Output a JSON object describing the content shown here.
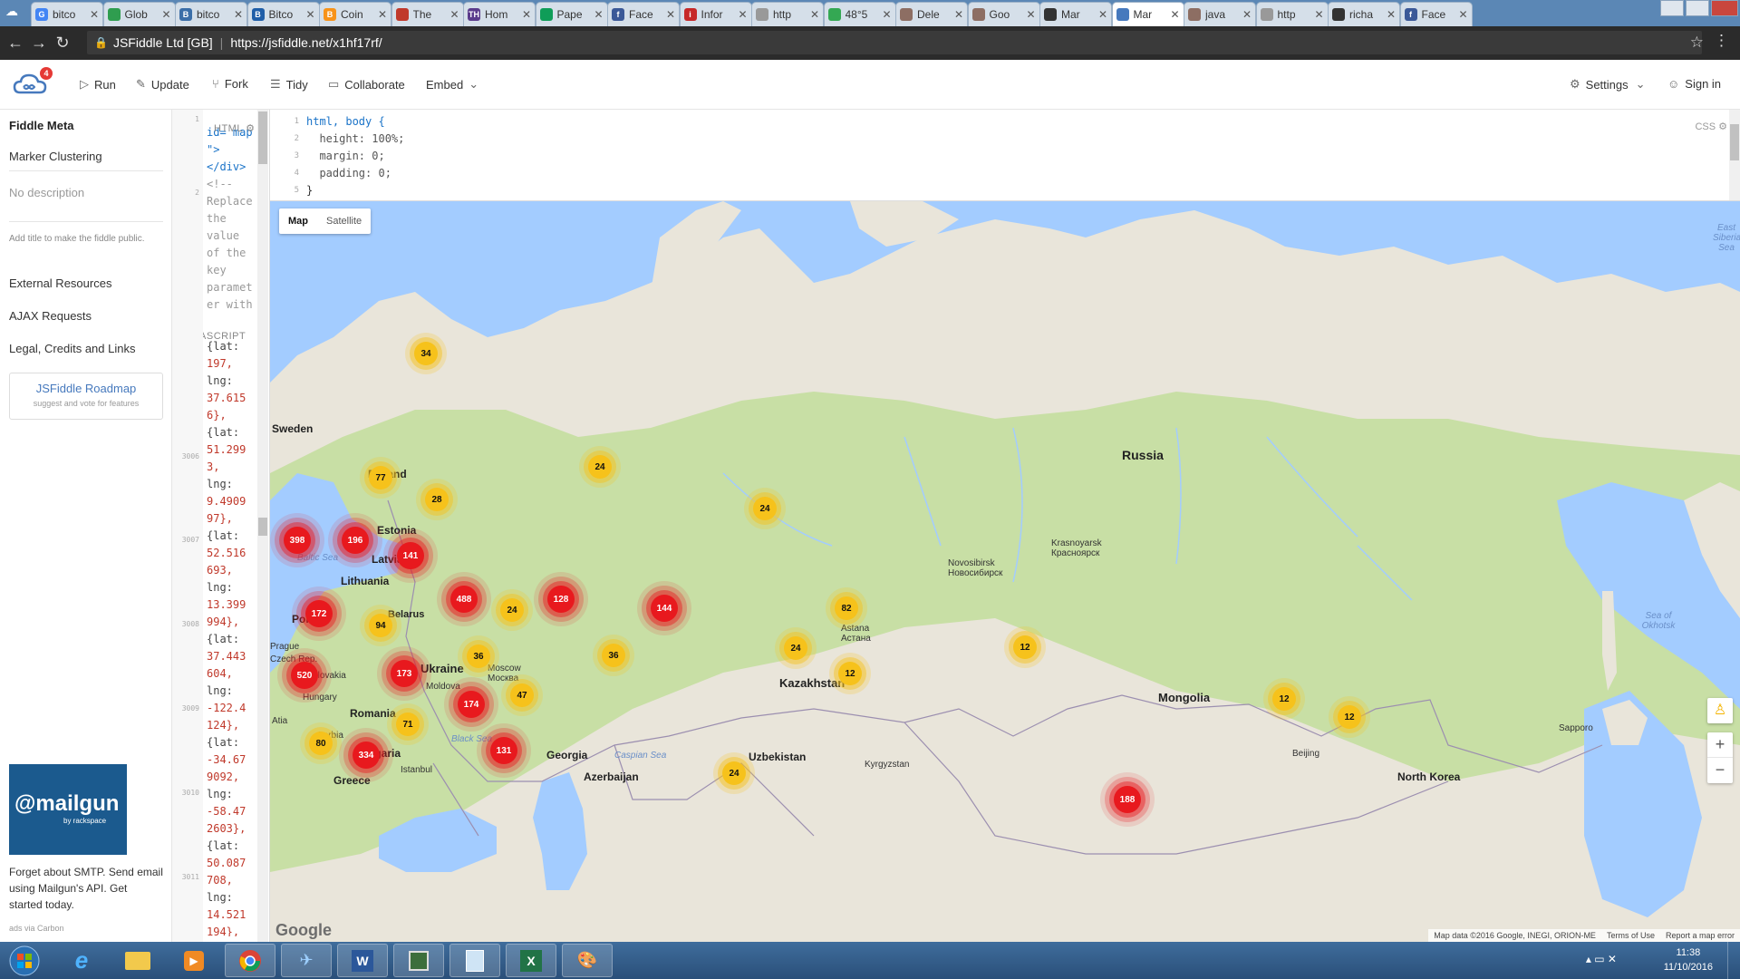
{
  "browser": {
    "tabs": [
      {
        "title": "bitco",
        "icon": "google-icon",
        "color": "#4285f4",
        "glyph": "G"
      },
      {
        "title": "Glob",
        "icon": "generic-page-icon",
        "color": "#2f9d4f",
        "glyph": ""
      },
      {
        "title": "bitco",
        "icon": "bitcointalk-icon",
        "color": "#3b6ea8",
        "glyph": "B"
      },
      {
        "title": "Bitco",
        "icon": "bitcoin-b-icon",
        "color": "#1f5ea8",
        "glyph": "B"
      },
      {
        "title": "Coin",
        "icon": "bitcoin-icon",
        "color": "#f7931a",
        "glyph": "B"
      },
      {
        "title": "The",
        "icon": "bookmark-icon",
        "color": "#c0392b",
        "glyph": ""
      },
      {
        "title": "Hom",
        "icon": "th-icon",
        "color": "#5b3c8c",
        "glyph": "TH"
      },
      {
        "title": "Pape",
        "icon": "sheets-icon",
        "color": "#0f9d58",
        "glyph": ""
      },
      {
        "title": "Face",
        "icon": "facebook-icon",
        "color": "#3b5998",
        "glyph": "f"
      },
      {
        "title": "Infor",
        "icon": "info-icon",
        "color": "#c62828",
        "glyph": "i"
      },
      {
        "title": "http",
        "icon": "blank-page-icon",
        "color": "#999999",
        "glyph": ""
      },
      {
        "title": "48°5",
        "icon": "maps-icon",
        "color": "#34a853",
        "glyph": ""
      },
      {
        "title": "Dele",
        "icon": "tools-icon",
        "color": "#8d6e63",
        "glyph": ""
      },
      {
        "title": "Goo",
        "icon": "tools-icon",
        "color": "#8d6e63",
        "glyph": ""
      },
      {
        "title": "Mar",
        "icon": "github-icon",
        "color": "#333333",
        "glyph": ""
      },
      {
        "title": "Mar",
        "icon": "jsfiddle-icon",
        "color": "#4679bd",
        "glyph": ""
      },
      {
        "title": "java",
        "icon": "tools-icon",
        "color": "#8d6e63",
        "glyph": ""
      },
      {
        "title": "http",
        "icon": "blank-page-icon",
        "color": "#999999",
        "glyph": ""
      },
      {
        "title": "richa",
        "icon": "github-icon",
        "color": "#333333",
        "glyph": ""
      },
      {
        "title": "Face",
        "icon": "facebook-icon",
        "color": "#3b5998",
        "glyph": "f"
      }
    ],
    "active_tab_index": 15,
    "site_name": "JSFiddle Ltd [GB]",
    "url": "https://jsfiddle.net/x1hf17rf/"
  },
  "toolbar": {
    "badge": "4",
    "run": "Run",
    "update": "Update",
    "fork": "Fork",
    "tidy": "Tidy",
    "collaborate": "Collaborate",
    "embed": "Embed",
    "settings": "Settings",
    "signin": "Sign in"
  },
  "meta": {
    "heading": "Fiddle Meta",
    "title_value": "Marker Clustering",
    "description_placeholder": "No description",
    "public_hint": "Add title to make the fiddle public.",
    "links": [
      "External Resources",
      "AJAX Requests",
      "Legal, Credits and Links"
    ],
    "roadmap_title": "JSFiddle Roadmap",
    "roadmap_sub": "suggest and vote for features",
    "ad_brand": "@mailgun",
    "ad_brand_sub": "by rackspace",
    "ad_text": "Forget about SMTP. Send email using Mailgun's API. Get started today.",
    "ad_credit": "ads via Carbon"
  },
  "editors": {
    "html_label": "HTML",
    "html_lines": [
      "id= map",
      "\">",
      "</div>",
      "<!--",
      "Replace",
      "the",
      "value",
      "of the",
      "key",
      "paramet",
      "er with"
    ],
    "js_label": "JAVASCRIPT",
    "js_lines": [
      "{lat:",
      "197,",
      "lng:",
      "37.615",
      "6},",
      "{lat:",
      "51.299",
      "3,",
      "lng:",
      "9.4909",
      "97},",
      "{lat:",
      "52.516",
      "693,",
      "lng:",
      "13.399",
      "994},",
      "{lat:",
      "37.443",
      "604,",
      "lng:",
      "-122.4",
      "124},",
      "{lat:",
      "-34.67",
      "9092,",
      "lng:",
      "-58.47",
      "2603},",
      "{lat:",
      "50.087",
      "708,",
      "lng:",
      "14.521",
      "194},",
      "{lat:"
    ],
    "js_line_numbers": [
      "3006",
      "3007",
      "3008",
      "3009",
      "3010",
      "3011"
    ],
    "css_label": "CSS",
    "css_lines": [
      "html, body {",
      "  height: 100%;",
      "  margin: 0;",
      "  padding: 0;",
      "}"
    ]
  },
  "map": {
    "type_buttons": [
      "Map",
      "Satellite"
    ],
    "countries": [
      "Russia",
      "Kazakhstan",
      "Mongolia",
      "Ukraine",
      "Belarus",
      "Poland",
      "Finland",
      "Sweden",
      "Estonia",
      "Latvia",
      "Lithuania",
      "Romania",
      "Bulgaria",
      "Georgia",
      "Azerbaijan",
      "Uzbekistan",
      "Kyrgyzstan",
      "Hungary",
      "Slovakia",
      "Moldova",
      "Greece",
      "North Korea",
      "Serbia",
      "Czech Rep.",
      "Atia"
    ],
    "cities": [
      {
        "name": "Moscow",
        "name2": "Москва"
      },
      {
        "name": "Novosibirsk",
        "name2": "Новосибирск"
      },
      {
        "name": "Krasnoyarsk",
        "name2": "Красноярск"
      },
      {
        "name": "Astana",
        "name2": "Астана"
      },
      {
        "name": "Istanbul",
        "name2": ""
      },
      {
        "name": "Beijing",
        "name2": ""
      },
      {
        "name": "Sapporo",
        "name2": ""
      },
      {
        "name": "Prague",
        "name2": ""
      }
    ],
    "seas": [
      "Baltic Sea",
      "Black Sea",
      "Caspian Sea",
      "Sea of Okhotsk",
      "East Siberian Sea"
    ],
    "clusters": [
      "34",
      "77",
      "28",
      "24",
      "24",
      "398",
      "196",
      "141",
      "172",
      "488",
      "24",
      "128",
      "144",
      "82",
      "94",
      "36",
      "36",
      "24",
      "12",
      "12",
      "520",
      "173",
      "47",
      "174",
      "71",
      "80",
      "334",
      "131",
      "24",
      "12",
      "12",
      "188"
    ],
    "google_label": "Google",
    "attribution": [
      "Map data ©2016 Google, INEGI, ORION-ME",
      "Terms of Use",
      "Report a map error"
    ],
    "zoom_in": "+",
    "zoom_out": "−"
  },
  "taskbar": {
    "apps": [
      "windows-start-icon",
      "ie-icon",
      "explorer-icon",
      "media-player-icon",
      "chrome-icon",
      "network-icon",
      "word-icon",
      "calculator-icon",
      "notepad-icon",
      "excel-icon",
      "paint-icon"
    ],
    "time": "11:38",
    "date": "11/10/2016"
  },
  "colors": {
    "accent": "#4679bd",
    "cluster_yellow": "#f6c21b",
    "cluster_red": "#e8191e",
    "water": "#a3ccff",
    "land": "#e9e5da",
    "green": "#c8dfa5"
  }
}
